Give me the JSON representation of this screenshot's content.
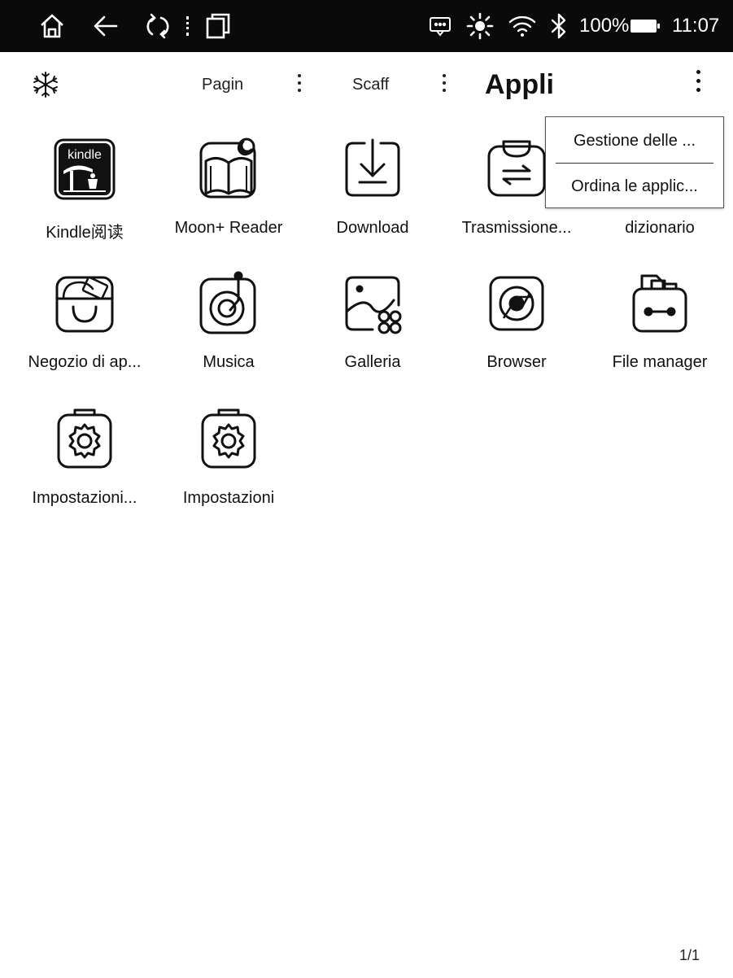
{
  "status_bar": {
    "icons": [
      "home-icon",
      "back-icon",
      "refresh-icon",
      "recent-apps-icon",
      "message-icon",
      "brightness-icon",
      "wifi-icon",
      "bluetooth-icon",
      "battery-icon"
    ],
    "battery_percent": "100%",
    "time": "11:07"
  },
  "tabs": {
    "freeze_icon": "snowflake-icon",
    "items": [
      {
        "label": "Pagin"
      },
      {
        "label": "Scaff"
      }
    ],
    "current": "Appli"
  },
  "menu": {
    "items": [
      {
        "label": "Gestione delle ..."
      },
      {
        "label": "Ordina le applic..."
      }
    ]
  },
  "apps": [
    {
      "label": "Kindle阅读",
      "icon": "kindle-icon",
      "icon_text": "kindle"
    },
    {
      "label": "Moon+ Reader",
      "icon": "moon-reader-icon"
    },
    {
      "label": "Download",
      "icon": "download-icon"
    },
    {
      "label": "Trasmissione...",
      "icon": "transfer-icon"
    },
    {
      "label": "dizionario",
      "icon": "dictionary-icon"
    },
    {
      "label": "Negozio di ap...",
      "icon": "app-store-icon"
    },
    {
      "label": "Musica",
      "icon": "music-icon"
    },
    {
      "label": "Galleria",
      "icon": "gallery-icon"
    },
    {
      "label": "Browser",
      "icon": "browser-icon"
    },
    {
      "label": "File manager",
      "icon": "file-manager-icon"
    },
    {
      "label": "Impostazioni...",
      "icon": "settings-icon"
    },
    {
      "label": "Impostazioni",
      "icon": "settings-icon"
    }
  ],
  "pager": "1/1"
}
